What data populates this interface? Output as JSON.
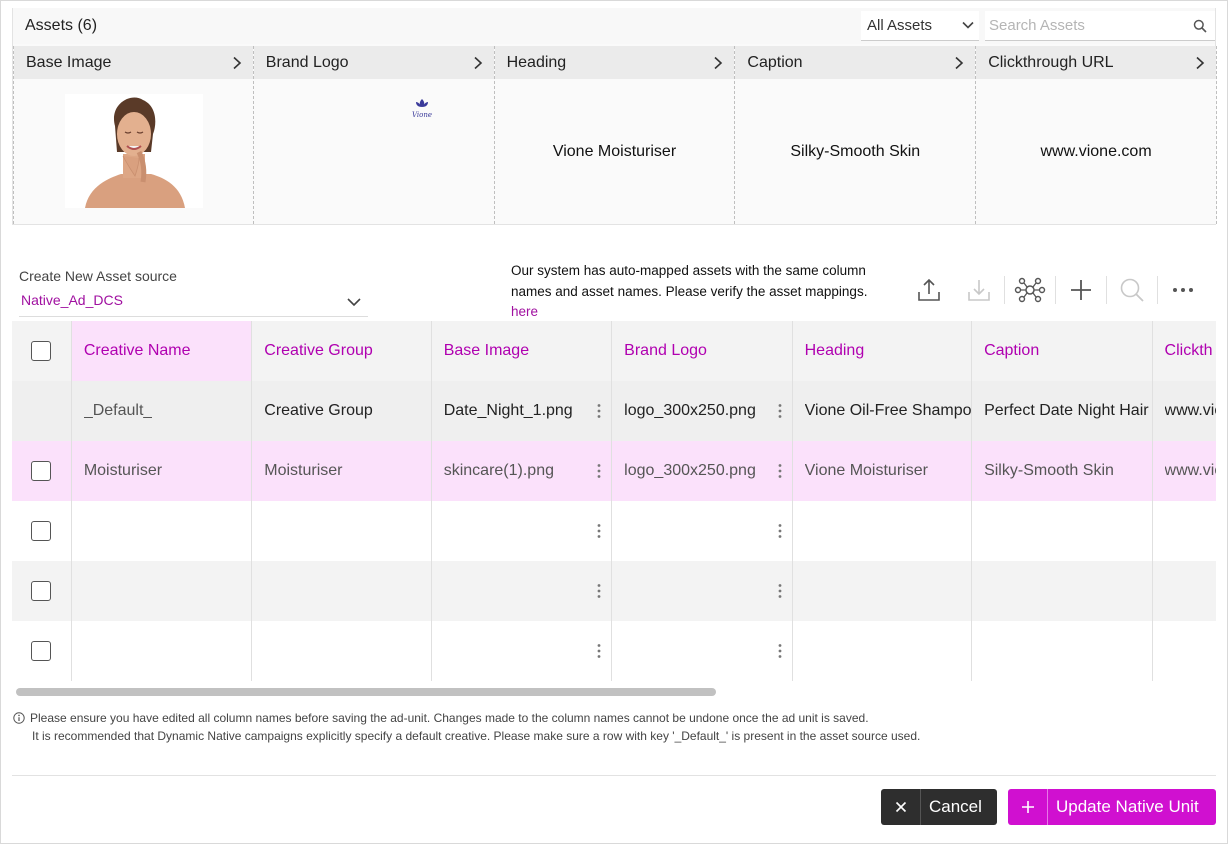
{
  "assets": {
    "title": "Assets (6)",
    "filter": "All Assets",
    "search_placeholder": "Search Assets",
    "columns": [
      {
        "label": "Base Image",
        "value": ""
      },
      {
        "label": "Brand Logo",
        "value": ""
      },
      {
        "label": "Heading",
        "value": "Vione Moisturiser"
      },
      {
        "label": "Caption",
        "value": "Silky-Smooth Skin"
      },
      {
        "label": "Clickthrough URL",
        "value": "www.vione.com"
      }
    ],
    "logo_text": "Vione"
  },
  "source": {
    "label": "Create New Asset source",
    "value": "Native_Ad_DCS"
  },
  "automap": {
    "text": "Our system has auto-mapped assets with the same column names and asset names. Please verify the asset mappings.",
    "link": "here"
  },
  "toolbar": {
    "icons": [
      "upload-icon",
      "download-icon",
      "mapping-icon",
      "add-icon",
      "search-icon",
      "more-icon"
    ]
  },
  "grid": {
    "headers": [
      "Creative Name",
      "Creative Group",
      "Base Image",
      "Brand Logo",
      "Heading",
      "Caption",
      "Clickth"
    ],
    "rows": [
      {
        "creative_name": "_Default_",
        "creative_group": "Creative Group",
        "base_image": "Date_Night_1.png",
        "brand_logo": "logo_300x250.png",
        "heading": "Vione Oil-Free Shampoo",
        "caption": "Perfect Date Night Hair",
        "clickthrough": "www.vione.com"
      },
      {
        "creative_name": "Moisturiser",
        "creative_group": "Moisturiser",
        "base_image": "skincare(1).png",
        "brand_logo": "logo_300x250.png",
        "heading": "Vione Moisturiser",
        "caption": "Silky-Smooth Skin",
        "clickthrough": "www.vione.com"
      }
    ]
  },
  "notes": {
    "line1": "Please ensure you have edited all column names before saving the ad-unit. Changes made to the column names cannot be undone once the ad unit is saved.",
    "line2": "It is recommended that Dynamic Native campaigns explicitly specify a default creative. Please make sure a row with key '_Default_' is present in the asset source used."
  },
  "buttons": {
    "cancel": "Cancel",
    "update": "Update Native Unit"
  },
  "colors": {
    "accent": "#d010d0",
    "accent_light": "#fbe1fb",
    "dark_button": "#2e2e2e"
  }
}
